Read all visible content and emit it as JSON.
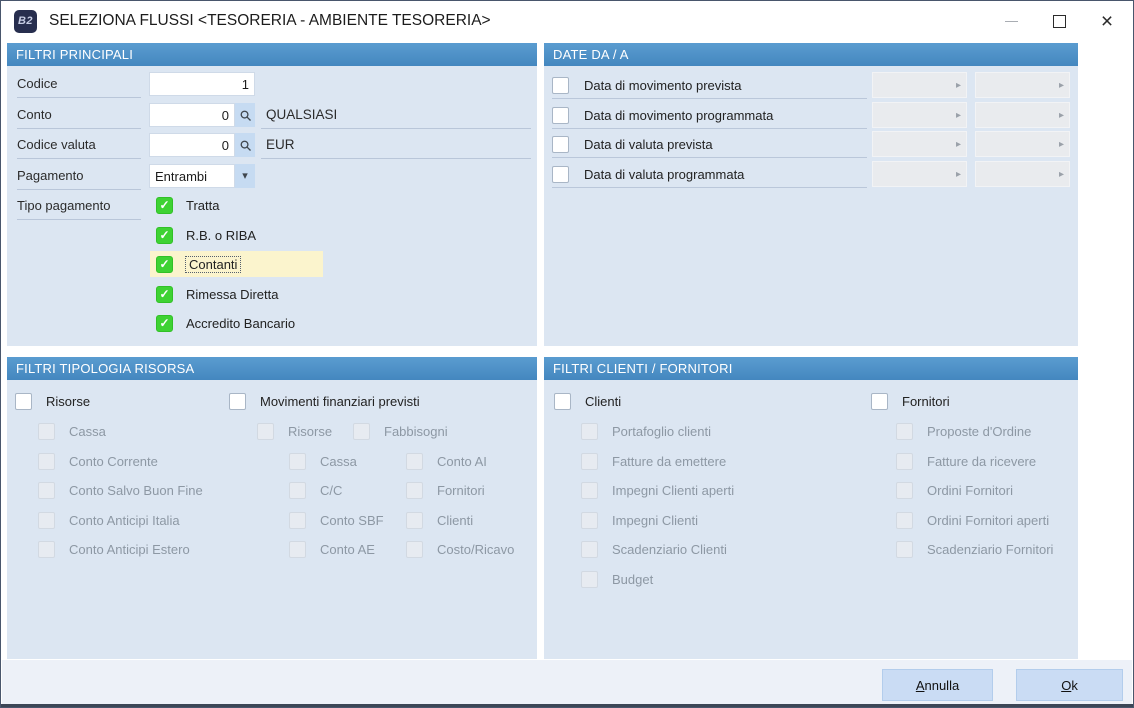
{
  "window": {
    "title": "SELEZIONA FLUSSI <TESORERIA - AMBIENTE TESORERIA>",
    "icon_text": "B2"
  },
  "icons": {
    "check": "✓",
    "dropdown": "▾",
    "date_next": "▸",
    "close": "×"
  },
  "colors": {
    "section_header_blue": "#4f93c8",
    "panel_background": "#dce6f2",
    "checked_green": "#3ed233",
    "focus_highlight_yellow": "#fbf4cd",
    "button_blue": "#cadcf4",
    "app_icon_navy": "#272e4e"
  },
  "filtri_principali": {
    "title": "FILTRI PRINCIPALI",
    "fields": [
      {
        "label": "Codice",
        "value": "1"
      },
      {
        "label": "Conto",
        "value": "0",
        "display": "QUALSIASI"
      },
      {
        "label": "Codice valuta",
        "value": "0",
        "display": "EUR"
      },
      {
        "label": "Pagamento",
        "value": "Entrambi"
      }
    ],
    "tipo_pagamento": {
      "label": "Tipo pagamento",
      "options": [
        {
          "label": "Tratta",
          "checked": true
        },
        {
          "label": "R.B. o RIBA",
          "checked": true
        },
        {
          "label": "Contanti",
          "checked": true,
          "focused": true
        },
        {
          "label": "Rimessa Diretta",
          "checked": true
        },
        {
          "label": "Accredito Bancario",
          "checked": true
        }
      ]
    }
  },
  "date_da_a": {
    "title": "DATE DA / A",
    "rows": [
      {
        "label": "Data di movimento prevista",
        "checked": false
      },
      {
        "label": "Data di movimento programmata",
        "checked": false
      },
      {
        "label": "Data di valuta prevista",
        "checked": false
      },
      {
        "label": "Data di valuta programmata",
        "checked": false
      }
    ]
  },
  "filtri_tipologia_risorsa": {
    "title": "FILTRI TIPOLOGIA RISORSA",
    "risorse": {
      "label": "Risorse",
      "checked": false,
      "children": [
        "Cassa",
        "Conto Corrente",
        "Conto Salvo Buon Fine",
        "Conto Anticipi Italia",
        "Conto Anticipi Estero"
      ]
    },
    "movimenti_finanziari": {
      "label": "Movimenti finanziari previsti",
      "checked": false,
      "row1": [
        "Risorse",
        "Fabbisogni"
      ],
      "col_a": [
        "Cassa",
        "C/C",
        "Conto SBF",
        "Conto AE"
      ],
      "col_b": [
        "Conto AI",
        "Fornitori",
        "Clienti",
        "Costo/Ricavo"
      ]
    }
  },
  "filtri_clienti_fornitori": {
    "title": "FILTRI CLIENTI / FORNITORI",
    "clienti": {
      "label": "Clienti",
      "checked": false,
      "children": [
        "Portafoglio clienti",
        "Fatture da emettere",
        "Impegni Clienti aperti",
        "Impegni Clienti",
        "Scadenziario Clienti",
        "Budget"
      ]
    },
    "fornitori": {
      "label": "Fornitori",
      "checked": false,
      "children": [
        "Proposte d'Ordine",
        "Fatture da ricevere",
        "Ordini Fornitori",
        "Ordini Fornitori aperti",
        "Scadenziario Fornitori"
      ]
    }
  },
  "footer": {
    "cancel_label": "Annulla",
    "ok_label": "Ok"
  }
}
